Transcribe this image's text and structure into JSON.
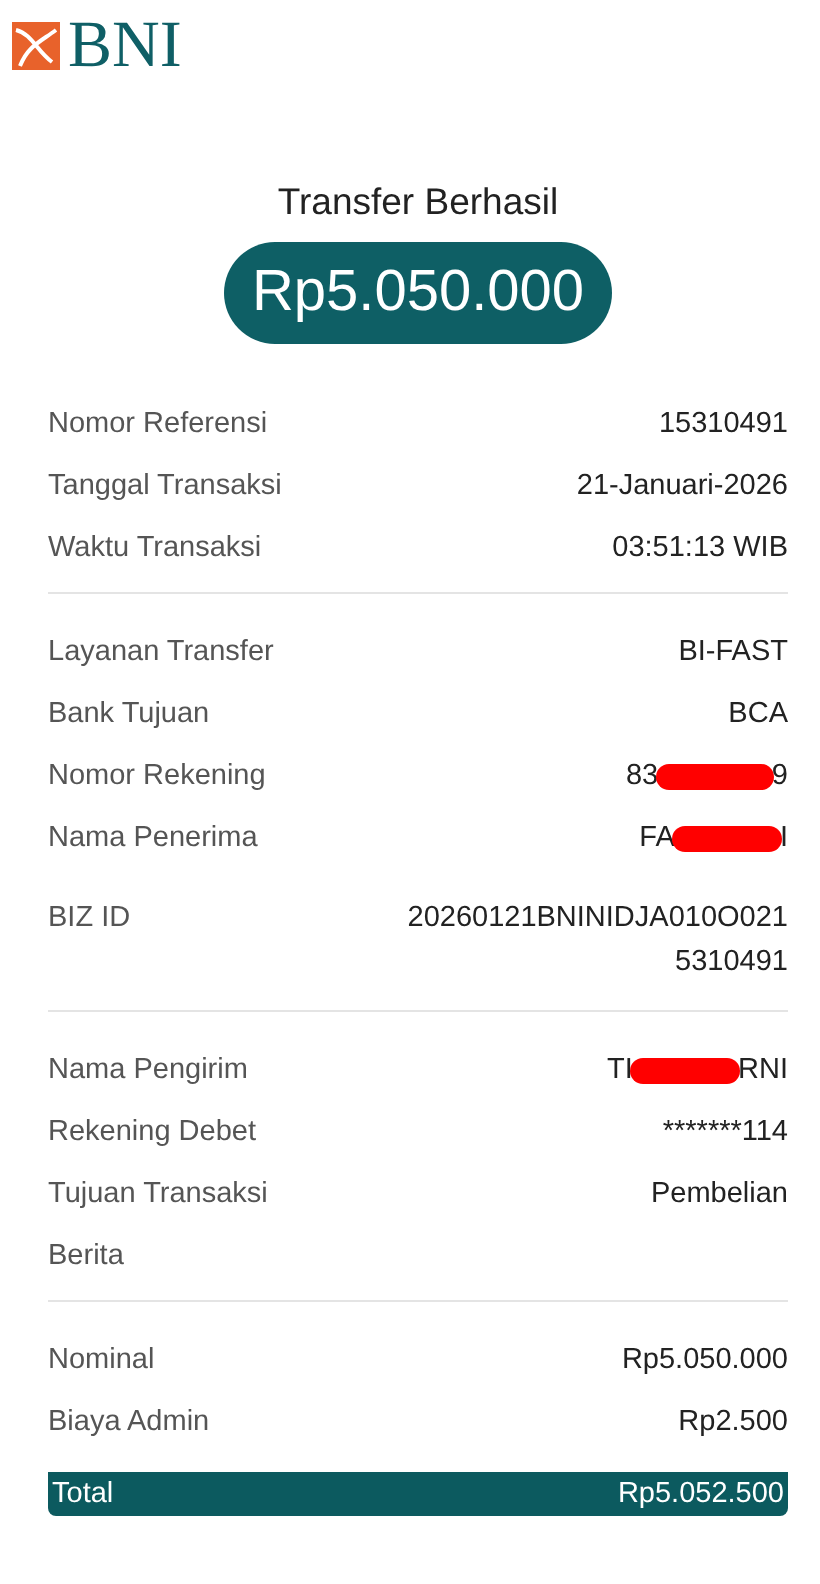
{
  "logo": {
    "text": "BNI"
  },
  "title": "Transfer Berhasil",
  "amount": "Rp5.050.000",
  "sections": [
    [
      {
        "kind": "plain",
        "label": "Nomor Referensi",
        "value": "15310491"
      },
      {
        "kind": "plain",
        "label": "Tanggal Transaksi",
        "value": "21-Januari-2026"
      },
      {
        "kind": "plain",
        "label": "Waktu Transaksi",
        "value": "03:51:13 WIB"
      }
    ],
    [
      {
        "kind": "plain",
        "label": "Layanan Transfer",
        "value": "BI-FAST"
      },
      {
        "kind": "plain",
        "label": "Bank Tujuan",
        "value": "BCA"
      },
      {
        "kind": "redacted",
        "label": "Nomor Rekening",
        "shown_start": "83",
        "shown_end": "9"
      },
      {
        "kind": "redacted",
        "label": "Nama Penerima",
        "shown_start": "FA",
        "shown_end": "I"
      },
      {
        "kind": "multiline",
        "label": "BIZ ID",
        "value_lines": [
          "20260121BNINIDJA010O021",
          "5310491"
        ]
      }
    ],
    [
      {
        "kind": "redacted",
        "label": "Nama Pengirim",
        "shown_start": "TI",
        "shown_end": "RNI"
      },
      {
        "kind": "plain",
        "label": "Rekening Debet",
        "value": "*******114"
      },
      {
        "kind": "plain",
        "label": "Tujuan Transaksi",
        "value": "Pembelian"
      },
      {
        "kind": "empty",
        "label": "Berita"
      }
    ],
    [
      {
        "kind": "plain",
        "label": "Nominal",
        "value": "Rp5.050.000"
      },
      {
        "kind": "plain",
        "label": "Biaya Admin",
        "value": "Rp2.500"
      }
    ]
  ],
  "total": {
    "label": "Total",
    "value": "Rp5.052.500"
  }
}
